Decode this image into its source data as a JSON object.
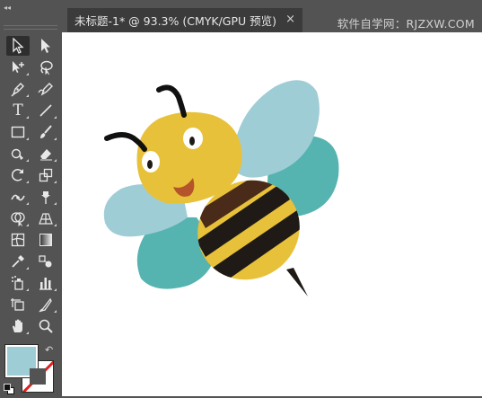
{
  "document_tab": {
    "title": "未标题-1* @ 93.3% (CMYK/GPU 预览)",
    "close_glyph": "×"
  },
  "watermark": "软件自学网：RJZXW.COM",
  "toolbar": {
    "collapse_glyph": "◂◂",
    "tools": [
      {
        "row": 1,
        "col": 1,
        "icon": "selection-tool-icon",
        "active": true
      },
      {
        "row": 1,
        "col": 2,
        "icon": "direct-selection-tool-icon"
      },
      {
        "row": 2,
        "col": 1,
        "icon": "magic-wand-tool-icon"
      },
      {
        "row": 2,
        "col": 2,
        "icon": "lasso-tool-icon"
      },
      {
        "row": 3,
        "col": 1,
        "icon": "pen-tool-icon"
      },
      {
        "row": 3,
        "col": 2,
        "icon": "curvature-tool-icon"
      },
      {
        "row": 4,
        "col": 1,
        "icon": "type-tool-icon",
        "glyph": "T"
      },
      {
        "row": 4,
        "col": 2,
        "icon": "line-segment-tool-icon"
      },
      {
        "row": 5,
        "col": 1,
        "icon": "rectangle-tool-icon"
      },
      {
        "row": 5,
        "col": 2,
        "icon": "paintbrush-tool-icon"
      },
      {
        "row": 6,
        "col": 1,
        "icon": "shaper-tool-icon"
      },
      {
        "row": 6,
        "col": 2,
        "icon": "eraser-tool-icon"
      },
      {
        "row": 7,
        "col": 1,
        "icon": "rotate-tool-icon"
      },
      {
        "row": 7,
        "col": 2,
        "icon": "scale-tool-icon"
      },
      {
        "row": 8,
        "col": 1,
        "icon": "width-tool-icon"
      },
      {
        "row": 8,
        "col": 2,
        "icon": "puppet-warp-tool-icon"
      },
      {
        "row": 9,
        "col": 1,
        "icon": "shape-builder-tool-icon"
      },
      {
        "row": 9,
        "col": 2,
        "icon": "perspective-grid-tool-icon"
      },
      {
        "row": 10,
        "col": 1,
        "icon": "mesh-tool-icon"
      },
      {
        "row": 10,
        "col": 2,
        "icon": "gradient-tool-icon"
      },
      {
        "row": 11,
        "col": 1,
        "icon": "eyedropper-tool-icon"
      },
      {
        "row": 11,
        "col": 2,
        "icon": "blend-tool-icon"
      },
      {
        "row": 12,
        "col": 1,
        "icon": "symbol-sprayer-tool-icon"
      },
      {
        "row": 12,
        "col": 2,
        "icon": "column-graph-tool-icon"
      },
      {
        "row": 13,
        "col": 1,
        "icon": "artboard-tool-icon"
      },
      {
        "row": 13,
        "col": 2,
        "icon": "slice-tool-icon"
      },
      {
        "row": 14,
        "col": 1,
        "icon": "hand-tool-icon"
      },
      {
        "row": 14,
        "col": 2,
        "icon": "zoom-tool-icon"
      }
    ],
    "fill_color": "#9fcdd6",
    "stroke_color": "none",
    "swap_glyph": "↶"
  },
  "colors": {
    "ui_background": "#535353",
    "tab_background": "#3b3b3b",
    "canvas": "#ffffff",
    "bee_yellow": "#e8c13a",
    "bee_stripe": "#1f1a15",
    "bee_brown": "#4a2a18",
    "wing_light": "#9fcdd6",
    "wing_teal": "#55b3b0",
    "mouth": "#b5532a"
  }
}
